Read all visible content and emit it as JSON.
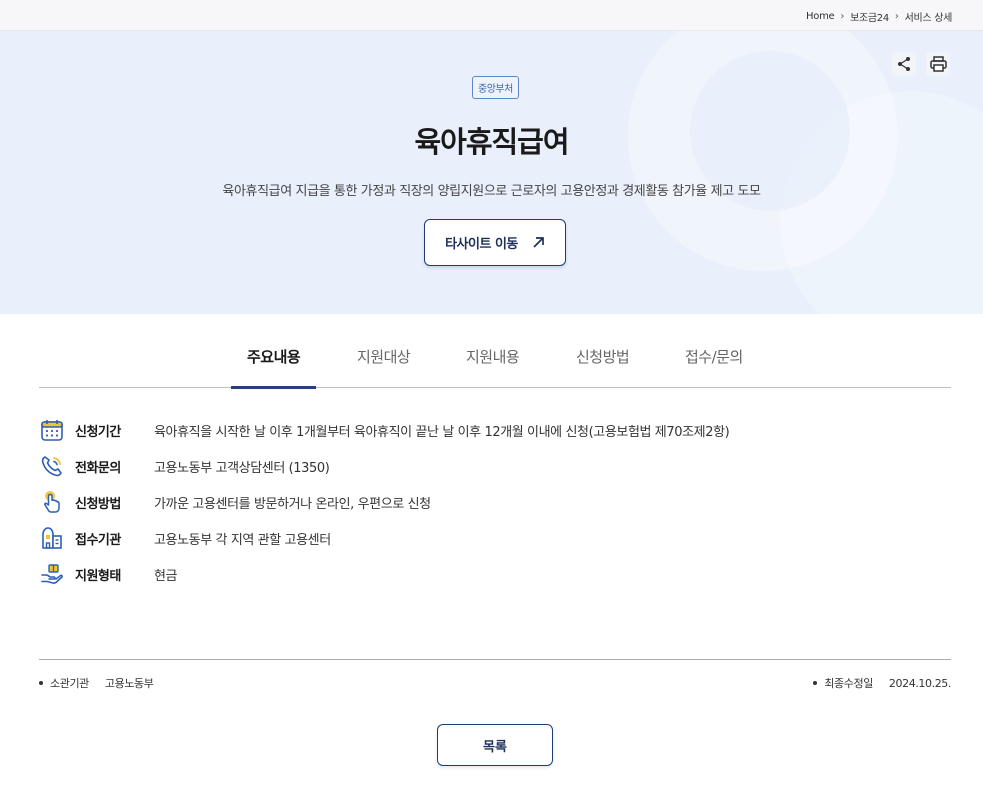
{
  "breadcrumb": [
    "Home",
    "보조금24",
    "서비스 상세"
  ],
  "hero": {
    "badge": "중앙부처",
    "title": "육아휴직급여",
    "description": "육아휴직급여 지급을 통한 가정과 직장의 양립지원으로 근로자의 고용안정과 경제활동 참가율 제고 도모",
    "site_button_label": "타사이트 이동",
    "share_icon": "share-icon",
    "print_icon": "printer-icon"
  },
  "tabs": [
    "주요내용",
    "지원대상",
    "지원내용",
    "신청방법",
    "접수/문의"
  ],
  "active_tab": "주요내용",
  "info": [
    {
      "icon": "calendar-icon",
      "label": "신청기간",
      "value": "육아휴직을 시작한 날 이후 1개월부터 육아휴직이 끝난 날 이후 12개월 이내에 신청(고용보험법 제70조제2항)"
    },
    {
      "icon": "phone-icon",
      "label": "전화문의",
      "value": "고용노동부 고객상담센터 (1350)"
    },
    {
      "icon": "hand-pointer-icon",
      "label": "신청방법",
      "value": "가까운 고용센터를 방문하거나 온라인, 우편으로 신청"
    },
    {
      "icon": "building-icon",
      "label": "접수기관",
      "value": "고용노동부 각 지역 관할 고용센터"
    },
    {
      "icon": "hand-gift-icon",
      "label": "지원형태",
      "value": "현금"
    }
  ],
  "footer": {
    "agency_label": "소관기관",
    "agency_value": "고용노동부",
    "updated_label": "최종수정일",
    "updated_value": "2024.10.25."
  },
  "list_button_label": "목록",
  "colors": {
    "hero_bg": "#e9f0fb",
    "accent_navy": "#1d3c78",
    "icon_blue": "#2f5fb3",
    "icon_yellow": "#f2c230"
  }
}
